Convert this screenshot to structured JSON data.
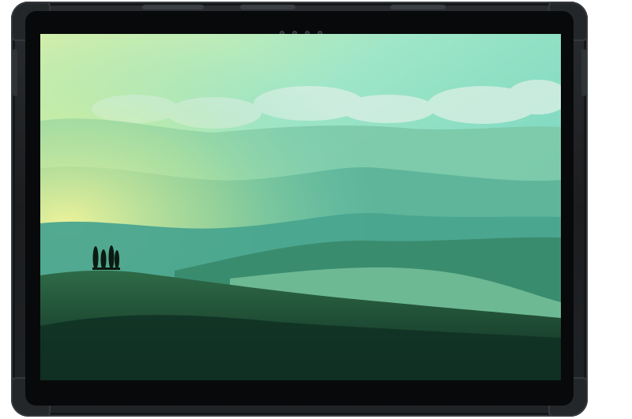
{
  "device": {
    "type": "tablet-in-rugged-case",
    "case_color": "#1e2124",
    "bezel_color": "#08090a"
  },
  "wallpaper": {
    "scene": "rolling-hills-landscape",
    "sky_top": "#7fe0c8",
    "sky_glow": "#e8f5a6",
    "haze": "#8fd9bf",
    "hill_dark": "#0f3b2c",
    "tree_color": "#0c1a12"
  }
}
